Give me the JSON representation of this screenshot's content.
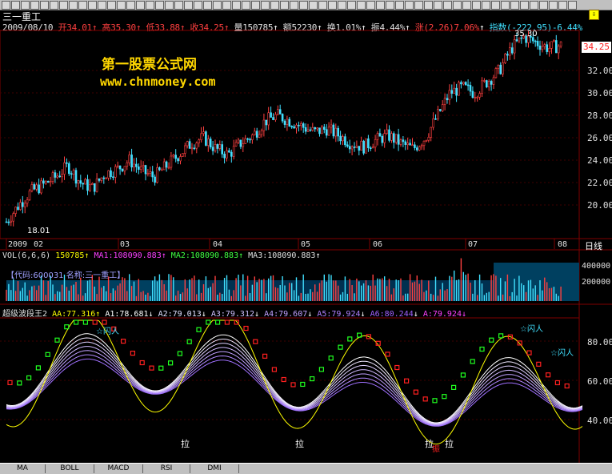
{
  "window": {
    "stock_name": "三一重工",
    "corner_icon": "down-arrow-icon"
  },
  "quote": {
    "date": "2009/08/10",
    "open": "开34.01",
    "high": "高35.30",
    "low": "低33.88",
    "close": "收34.25",
    "volume": "量150785",
    "amount": "额52230",
    "turnover": "换1.01%",
    "amplitude": "振4.44%",
    "change": "涨(2.26)7.06%",
    "index": "指数(-222.95)-6.44%"
  },
  "brand": {
    "line1": "第一股票公式网",
    "line2": "www.chnmoney.com"
  },
  "price_chart": {
    "y_ticks": [
      "34.25",
      "32.00",
      "30.00",
      "28.00",
      "26.00",
      "24.00",
      "22.00",
      "20.00"
    ],
    "high_label": "35.30",
    "low_label": "18.01",
    "current_price": "34.25",
    "x_ticks": [
      "2009",
      "02",
      "03",
      "04",
      "05",
      "06",
      "07",
      "08"
    ],
    "axis_name": "日线",
    "colors": {
      "up": "#ff4040",
      "down": "#40e0ff",
      "bg": "#000000"
    }
  },
  "volume_panel": {
    "title": "VOL(6,6,6)",
    "vol": "150785",
    "ma1": "MA1:108090.883",
    "ma2": "MA2:108090.883",
    "ma3": "MA3:108090.883",
    "code_label": "【代码:600031 名称:三一重工】",
    "y_ticks": [
      "400000",
      "200000"
    ]
  },
  "indicator_panel": {
    "title": "超级波段王2",
    "aa": "AA:77.316",
    "a1": "A1:78.681",
    "a2": "A2:79.013",
    "a3": "A3:79.312",
    "a4": "A4:79.607",
    "a5": "A5:79.924",
    "a6": "A6:80.244",
    "a": "A:79.924",
    "y_ticks": [
      "80.00",
      "60.00",
      "40.00"
    ],
    "annotations": {
      "pull": "拉",
      "flash": "☆闪人",
      "shake": "振"
    }
  },
  "tabs": [
    "MA",
    "BOLL",
    "MACD",
    "RSI",
    "DMI"
  ]
}
